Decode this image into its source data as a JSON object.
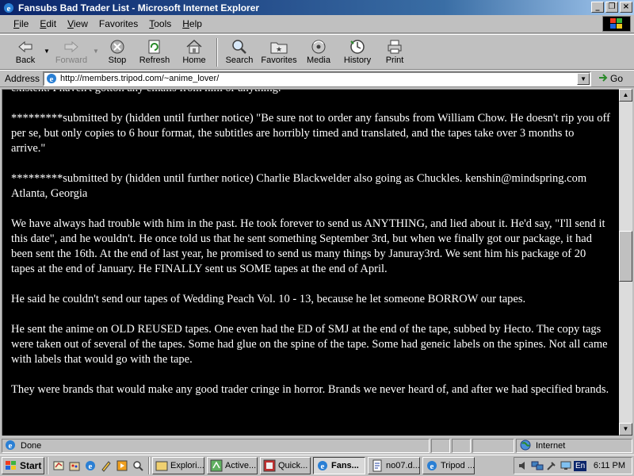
{
  "window": {
    "title": "Fansubs Bad Trader List - Microsoft Internet Explorer",
    "controls": {
      "minimize": "_",
      "maximize": "❐",
      "close": "×"
    }
  },
  "menu": {
    "items": [
      {
        "first": "F",
        "rest": "ile"
      },
      {
        "first": "E",
        "rest": "dit"
      },
      {
        "first": "V",
        "rest": "iew"
      },
      {
        "first": "F",
        "rest": "avorites",
        "prefix": "Fa",
        "tail": "vorites"
      },
      {
        "first": "T",
        "rest": "ools"
      },
      {
        "first": "H",
        "rest": "elp"
      }
    ]
  },
  "toolbar": {
    "back": "Back",
    "forward": "Forward",
    "stop": "Stop",
    "refresh": "Refresh",
    "home": "Home",
    "search": "Search",
    "favorites": "Favorites",
    "media": "Media",
    "history": "History",
    "print": "Print"
  },
  "address": {
    "label": "Address",
    "url": "http://members.tripod.com/~anime_lover/",
    "go": "Go"
  },
  "content": {
    "paragraphs": [
      "existent. I haven't gotton any emails from him or anything.\"",
      "*********submitted by (hidden until further notice) \"Be sure not to order any fansubs from William Chow. He doesn't rip you off per se, but only copies to 6 hour format, the subtitles are horribly timed and translated, and the tapes take over 3 months to arrive.\"",
      "*********submitted by (hidden until further notice) Charlie Blackwelder also going as Chuckles. kenshin@mindspring.com Atlanta, Georgia",
      "We have always had trouble with him in the past. He took forever to send us ANYTHING, and lied about it. He'd say, \"I'll send it this date\", and he wouldn't. He once told us that he sent something September 3rd, but when we finally got our package, it had been sent the 16th. At the end of last year, he promised to send us many things by Januray3rd. We sent him his package of 20 tapes at the end of January. He FINALLY sent us SOME tapes at the end of April.",
      "He said he couldn't send our tapes of Wedding Peach Vol. 10 - 13, because he let someone BORROW our tapes.",
      "He sent the anime on OLD REUSED tapes. One even had the ED of SMJ at the end of the tape, subbed by Hecto. The copy tags were taken out of several of the tapes. Some had glue on the spine of the tape. Some had geneic labels on the spines. Not all came with labels that would go with the tape.",
      "They were brands that would make any good trader cringe in horror. Brands we never heard of, and after we had specified brands."
    ]
  },
  "status": {
    "text": "Done",
    "zone": "Internet"
  },
  "taskbar": {
    "start": "Start",
    "tasks": [
      "Explori...",
      "Active...",
      "Quick...",
      "Fans...",
      "no07.d...",
      "Tripod ..."
    ],
    "language": "En",
    "clock": "6:11 PM"
  },
  "colors": {
    "titlebar": "#0a246a",
    "page_bg": "#000000",
    "page_text": "#ffffff",
    "chrome": "#c0c0c0"
  }
}
